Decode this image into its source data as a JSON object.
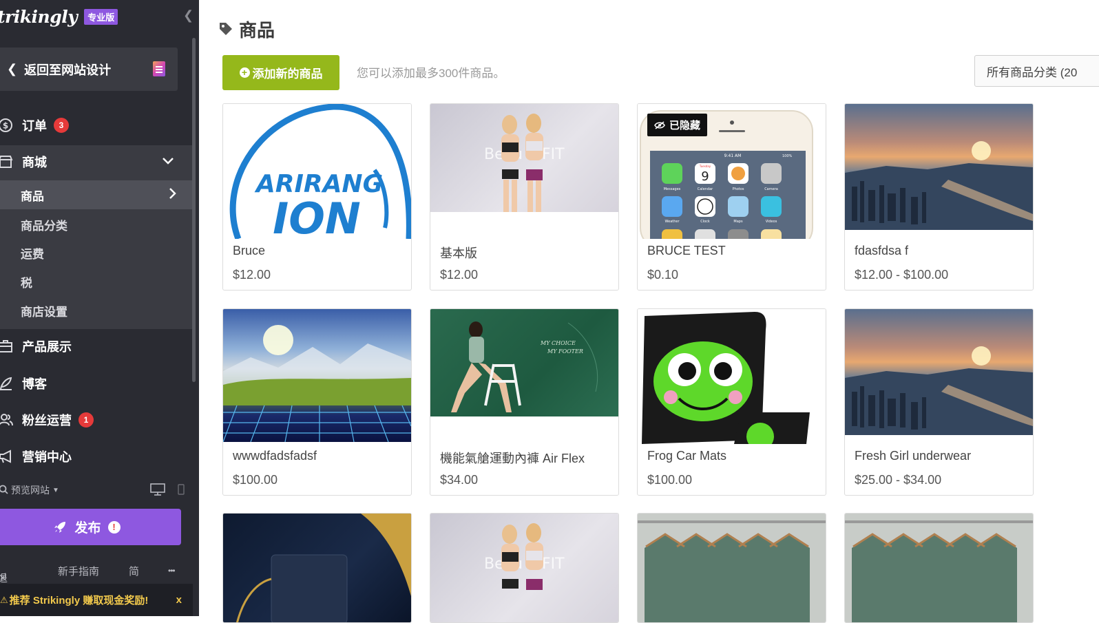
{
  "sidebar": {
    "brand": "trikingly",
    "plan_badge": "专业版",
    "back_label": "返回至网站设计",
    "nav": {
      "orders": {
        "label": "订单",
        "badge": "3"
      },
      "store": {
        "label": "商城"
      },
      "showcase": {
        "label": "产品展示"
      },
      "blog": {
        "label": "博客"
      },
      "fans": {
        "label": "粉丝运营",
        "badge": "1"
      },
      "marketing": {
        "label": "营销中心"
      }
    },
    "store_sub": [
      "商品",
      "商品分类",
      "运费",
      "税",
      "商店设置"
    ],
    "preview_label": "预览网站",
    "publish_label": "发布",
    "publish_alert": "!",
    "bottom": {
      "logout": "退出",
      "guide": "新手指南",
      "lang": "简",
      "more": "•••"
    },
    "promo": "推荐 Strikingly 赚取现金奖励!",
    "promo_close": "x"
  },
  "main": {
    "title": "商品",
    "add_button": "添加新的商品",
    "hint": "您可以添加最多300件商品。",
    "category_filter": "所有商品分类 (20",
    "hidden_label": "已隐藏",
    "products": [
      {
        "name": "Bruce",
        "price": "$12.00"
      },
      {
        "name": "基本版",
        "price": "$12.00"
      },
      {
        "name": "BRUCE TEST",
        "price": "$0.10"
      },
      {
        "name": "fdasfdsa f",
        "price": "$12.00 - $100.00"
      },
      {
        "name": "wwwdfadsfadsf",
        "price": "$100.00"
      },
      {
        "name": "機能氣艙運動內褲 Air Flex",
        "price": "$34.00"
      },
      {
        "name": "Frog Car Mats",
        "price": "$100.00"
      },
      {
        "name": "Fresh Girl underwear",
        "price": "$25.00 - $34.00"
      }
    ],
    "image_text": {
      "arirang": "ARIRANG",
      "ion": "ION",
      "beau": "Beau",
      "fit": "FIT",
      "phone_time": "9:41 AM",
      "phone_batt": "100%",
      "app_messages": "Messages",
      "app_calendar": "Calendar",
      "app_photos": "Photos",
      "app_camera": "Camera",
      "app_weather": "Weather",
      "app_clock": "Clock",
      "app_maps": "Maps",
      "app_videos": "Videos",
      "cal_day": "9",
      "cal_weekday": "Tuesday",
      "choice1": "MY CHOICE",
      "choice2": "MY FOOTER"
    }
  },
  "colors": {
    "accent_green": "#95b81b",
    "accent_purple": "#8e58e0",
    "sidebar_bg": "#2a2b32",
    "badge_red": "#e63a3a"
  }
}
